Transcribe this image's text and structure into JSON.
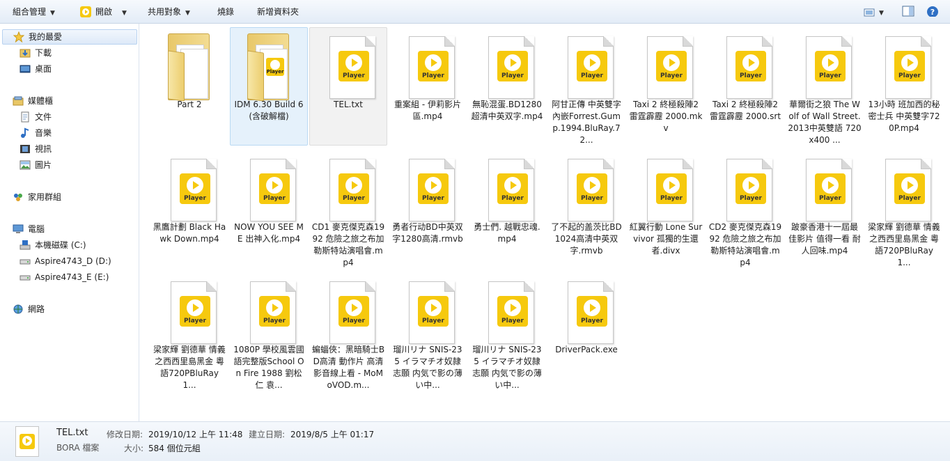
{
  "toolbar": {
    "organize": "組合管理",
    "open": "開啟",
    "share": "共用對象",
    "burn": "燒錄",
    "new_folder": "新增資料夾"
  },
  "sidebar": {
    "favorites": "我的最愛",
    "downloads": "下載",
    "desktop": "桌面",
    "libraries": "媒體櫃",
    "documents": "文件",
    "music": "音樂",
    "videos": "視訊",
    "pictures": "圖片",
    "homegroup": "家用群組",
    "computer": "電腦",
    "drive_c": "本機磁碟 (C:)",
    "drive_d": "Aspire4743_D (D:)",
    "drive_e": "Aspire4743_E (E:)",
    "network": "網路"
  },
  "files": [
    {
      "name": "Part 2",
      "type": "folder"
    },
    {
      "name": "IDM 6.30 Build 6 (含破解檔)",
      "type": "folder-player"
    },
    {
      "name": "TEL.txt",
      "type": "player"
    },
    {
      "name": "重案組 - 伊莉影片區.mp4",
      "type": "player"
    },
    {
      "name": "無恥混蛋.BD1280超清中英双字.mp4",
      "type": "player"
    },
    {
      "name": "阿甘正傳 中英雙字內嵌Forrest.Gump.1994.BluRay.72...",
      "type": "player"
    },
    {
      "name": "Taxi 2 終極殺陣2 雷霆霹靂 2000.mkv",
      "type": "player"
    },
    {
      "name": "Taxi 2 終極殺陣2 雷霆霹靂 2000.srt",
      "type": "player"
    },
    {
      "name": "華爾街之狼 The Wolf of Wall Street.2013中英雙語 720x400 ...",
      "type": "player"
    },
    {
      "name": "13小時 班加西的秘密士兵 中英雙字720P.mp4",
      "type": "player"
    },
    {
      "name": "黑鷹計劃 Black Hawk Down.mp4",
      "type": "player"
    },
    {
      "name": "NOW YOU SEE ME 出神入化.mp4",
      "type": "player"
    },
    {
      "name": "CD1 麥克傑克森1992 危險之旅之布加勒斯特站演唱會.mp4",
      "type": "player"
    },
    {
      "name": "勇者行动BD中英双字1280高清.rmvb",
      "type": "player"
    },
    {
      "name": "勇士們. 越戰忠魂.mp4",
      "type": "player"
    },
    {
      "name": "了不起的盖茨比BD1024高清中英双字.rmvb",
      "type": "player"
    },
    {
      "name": "紅翼行動 Lone Survivor 孤獨的生還者.divx",
      "type": "player"
    },
    {
      "name": "CD2 麥克傑克森1992 危險之旅之布加勒斯特站演唱會.mp4",
      "type": "player"
    },
    {
      "name": "跛豪香港十一屆最佳影片 值得一看 耐人回味.mp4",
      "type": "player"
    },
    {
      "name": "梁家輝 劉德華 情義之西西里島黑金 粵語720PBluRay 1...",
      "type": "player"
    },
    {
      "name": "梁家輝 劉德華 情義之西西里島黑金 粵語720PBluRay 1...",
      "type": "player"
    },
    {
      "name": "1080P 學校風雲國語完整版School On Fire 1988 劉松仁 袁...",
      "type": "player"
    },
    {
      "name": "蝙蝠俠：黑暗騎士BD高清 動作片 高清影音線上看 - MoMoVOD.m...",
      "type": "player"
    },
    {
      "name": "瑠川リナ SNIS-235 イラマチオ奴隷志願 内気で影の薄い中...",
      "type": "player"
    },
    {
      "name": "瑠川リナ SNIS-235 イラマチオ奴隷志願 内気で影の薄い中...",
      "type": "player"
    },
    {
      "name": "DriverPack.exe",
      "type": "player"
    }
  ],
  "player_label": "Player",
  "details": {
    "filename": "TEL.txt",
    "filetype": "BORA 檔案",
    "modified_label": "修改日期:",
    "modified_value": "2019/10/12 上午 11:48",
    "created_label": "建立日期:",
    "created_value": "2019/8/5 上午 01:17",
    "size_label": "大小:",
    "size_value": "584 個位元組"
  },
  "colors": {
    "player_yellow": "#f6c90e",
    "selection_blue": "#e5f1fb"
  }
}
